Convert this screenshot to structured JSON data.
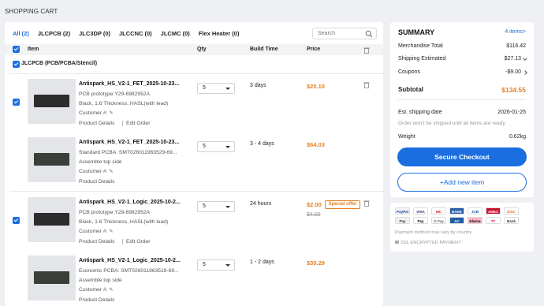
{
  "page": {
    "title": "SHOPPING CART"
  },
  "tabs": [
    {
      "label": "All (2)",
      "active": true
    },
    {
      "label": "JLCPCB (2)",
      "active": false
    },
    {
      "label": "JLC3DP (0)",
      "active": false
    },
    {
      "label": "JLCCNC (0)",
      "active": false
    },
    {
      "label": "JLCMC (0)",
      "active": false
    },
    {
      "label": "Flex Heater (0)",
      "active": false
    }
  ],
  "search": {
    "placeholder": "Search"
  },
  "table": {
    "headers": {
      "item": "Item",
      "qty": "Qty",
      "build_time": "Build Time",
      "price": "Price"
    },
    "group_label": "JLCPCB (PCB/PCBA/Stencil)"
  },
  "items": [
    {
      "name": "Antispark_HS_V2-1_FET_2025-10-23...",
      "line1": "PCB prototype:Y29-6982952A",
      "line2": "Black, 1.6 Thickness, HASL(with lead)",
      "customer": "Customer #:",
      "details": "Product Details",
      "edit": "Edit Order",
      "qty": "5",
      "build_time": "3 days",
      "price": "$20.10",
      "checked": true,
      "has_trash": true
    },
    {
      "name": "Antispark_HS_V2-1_FET_2025-10-23...",
      "line1": "Standard PCBA: SMT026011963529-69...",
      "line2": "Assemble top side",
      "customer": "Customer #:",
      "details": "Product Details",
      "edit": "",
      "qty": "5",
      "build_time": "3 - 4 days",
      "price": "$64.03",
      "checked": false,
      "has_trash": false
    },
    {
      "name": "Antispark_HS_V2-1_Logic_2025-10-2...",
      "line1": "PCB prototype:Y28-6982952A",
      "line2": "Black, 1.6 Thickness, HASL(with lead)",
      "customer": "Customer #:",
      "details": "Product Details",
      "edit": "Edit Order",
      "qty": "5",
      "build_time": "24 hours",
      "price": "$2.00",
      "price_old": "$4.00",
      "badge": "Special offer",
      "checked": true,
      "has_trash": true
    },
    {
      "name": "Antispark_HS_V2-1_Logic_2025-10-2...",
      "line1": "Economic PCBA: SMT026011963519-69...",
      "line2": "Assemble top side",
      "customer": "Customer #:",
      "details": "Product Details",
      "edit": "",
      "qty": "5",
      "build_time": "1 - 2 days",
      "price": "$30.29",
      "checked": false,
      "has_trash": false
    }
  ],
  "summary": {
    "title": "SUMMARY",
    "count": "4 items>",
    "merch_label": "Merchandise Total",
    "merch_value": "$116.42",
    "ship_label": "Shipping Estimated",
    "ship_value": "$27.13",
    "coupon_label": "Coupons",
    "coupon_value": "-$9.00",
    "subtotal_label": "Subtotal",
    "subtotal_value": "$134.55",
    "est_label": "Est. shipping date",
    "est_value": "2026-01-25",
    "ship_note": "Order won't be shipped until all items are ready.",
    "weight_label": "Weight",
    "weight_value": "0.62kg",
    "checkout": "Secure Checkout",
    "add_new": "+Add new item"
  },
  "payments": {
    "methods": [
      {
        "label": "PayPal",
        "color": "#f1f5fb",
        "text": "#1d3a8a"
      },
      {
        "label": "VISA",
        "color": "#ffffff",
        "text": "#1a1f71"
      },
      {
        "label": "MC",
        "color": "#ffffff",
        "text": "#eb001b"
      },
      {
        "label": "BANK",
        "color": "#2b5ea8",
        "text": "#ffffff"
      },
      {
        "label": "JCB",
        "color": "#ffffff",
        "text": "#0b4ea2"
      },
      {
        "label": "AMEX",
        "color": "#c8102e",
        "text": "#ffffff"
      },
      {
        "label": "DISC",
        "color": "#ffffff",
        "text": "#f26522"
      },
      {
        "label": "Pay",
        "color": "#f1f1f1",
        "text": "#333333"
      },
      {
        "label": "Pay",
        "color": "#ffffff",
        "text": "#000000"
      },
      {
        "label": "G Pay",
        "color": "#ffffff",
        "text": "#5f6368"
      },
      {
        "label": "AC",
        "color": "#1f5fa8",
        "text": "#ffffff"
      },
      {
        "label": "Klarna",
        "color": "#ffb3c7",
        "text": "#000000"
      },
      {
        "label": "TT",
        "color": "#ffffff",
        "text": "#c8102e"
      },
      {
        "label": "Bank",
        "color": "#ffffff",
        "text": "#333333"
      }
    ],
    "note": "Payment method may vary by country.",
    "ssl": "SSL ENCRYPTED PAYMENT"
  },
  "colors": {
    "accent": "#1a6ee0",
    "price": "#e67e22"
  }
}
